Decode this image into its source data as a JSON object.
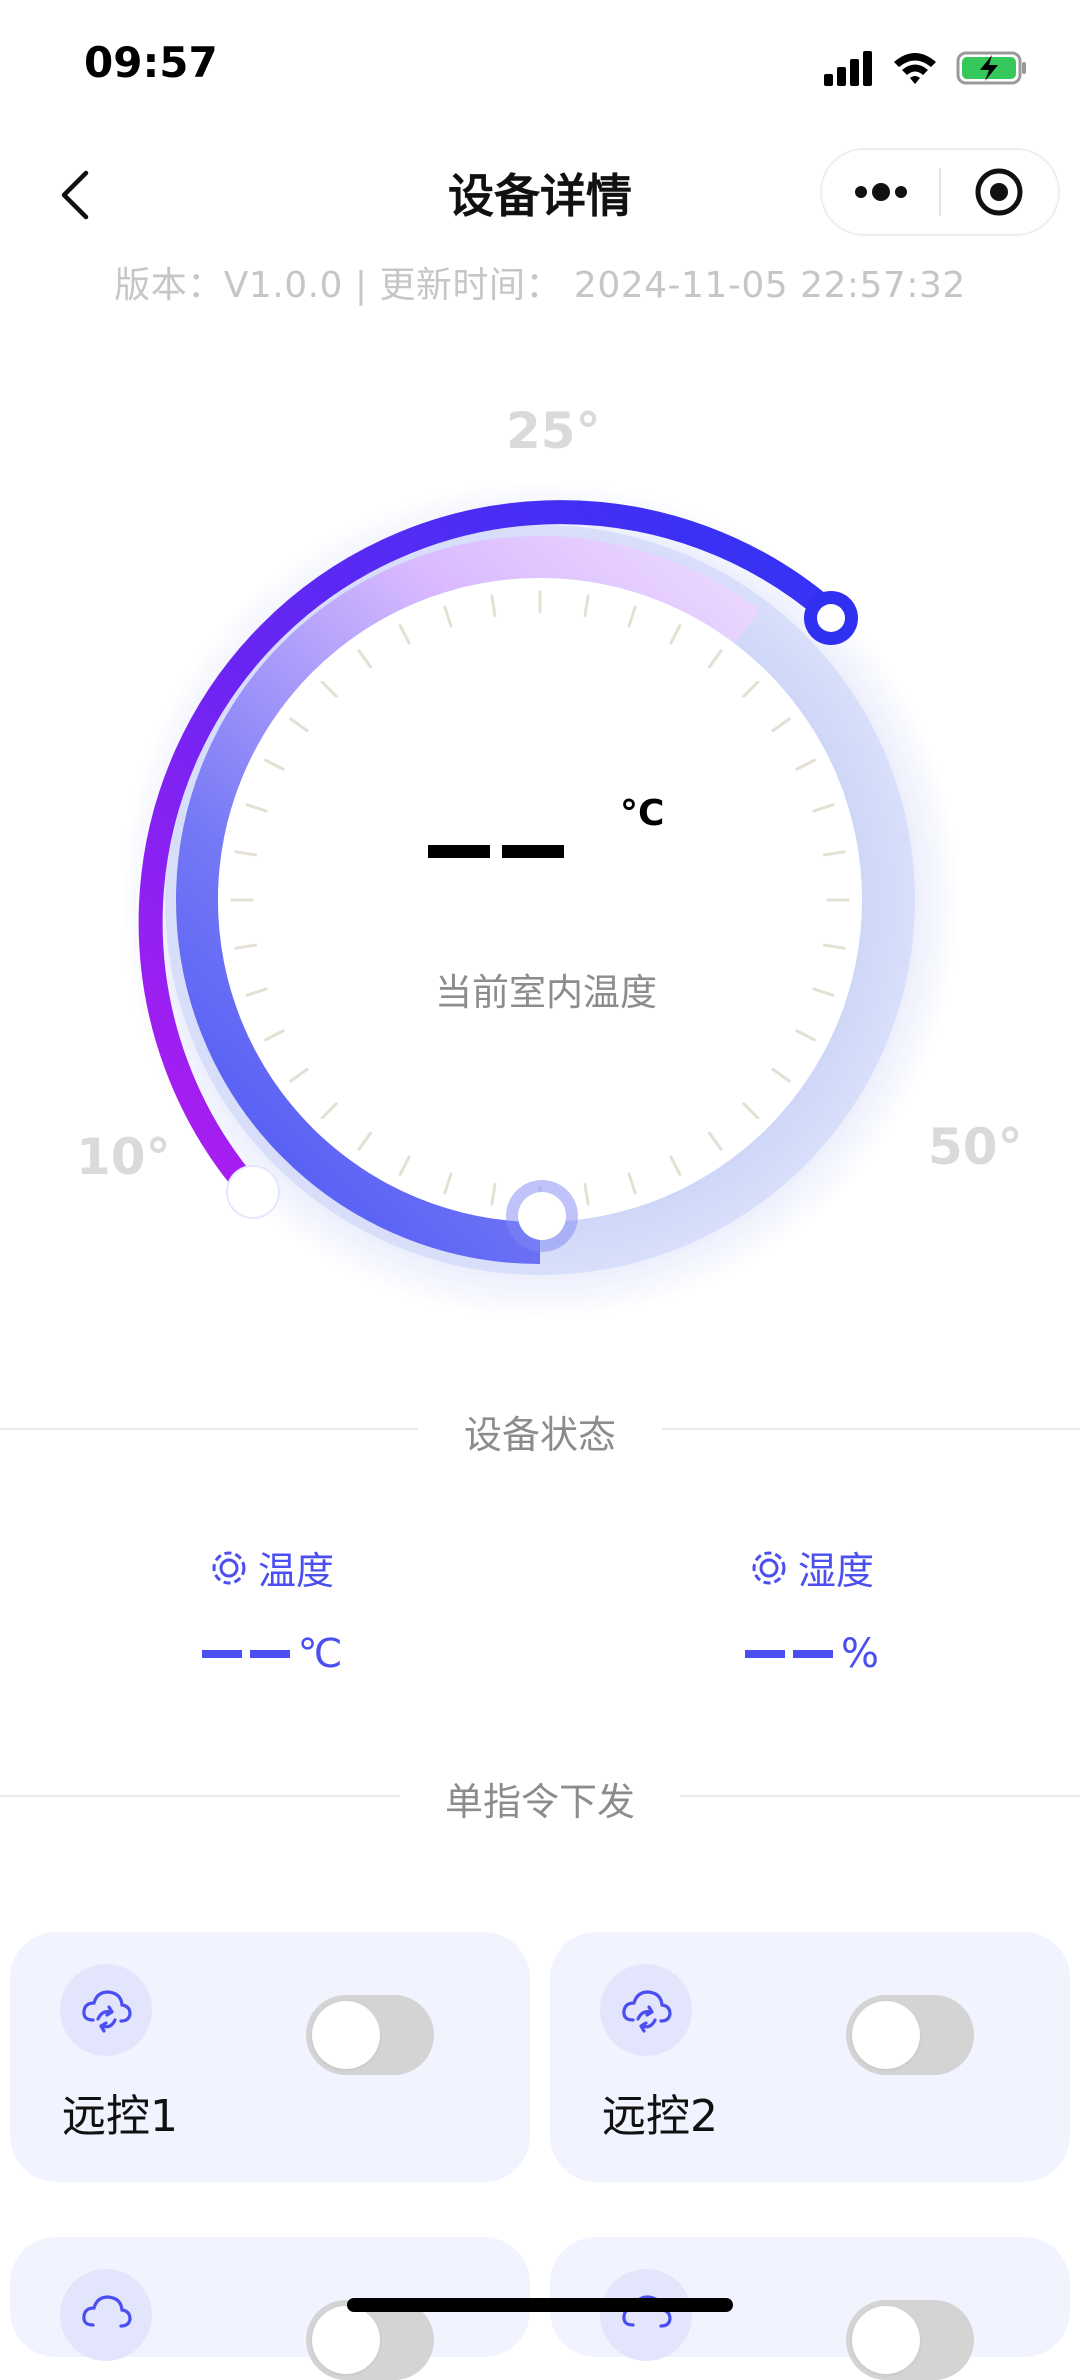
{
  "status_bar": {
    "time": "09:57"
  },
  "nav": {
    "title": "设备详情"
  },
  "version_line": "版本：V1.0.0 | 更新时间： 2024-11-05 22:57:32",
  "dial": {
    "scale_min_label": "10°",
    "scale_mid_label": "25°",
    "scale_max_label": "50°",
    "unit": "°C",
    "caption": "当前室内温度",
    "current_reading": null,
    "gradient_colors": [
      "#b21cf0",
      "#3d2ff5",
      "#4d5af5"
    ]
  },
  "sections": {
    "device_status": "设备状态",
    "single_command": "单指令下发"
  },
  "stats": [
    {
      "label": "温度",
      "unit": "℃"
    },
    {
      "label": "湿度",
      "unit": "%"
    }
  ],
  "cards": [
    {
      "label": "远控1",
      "on": false
    },
    {
      "label": "远控2",
      "on": false
    }
  ],
  "colors": {
    "accent": "#4b4ff0",
    "card_bg": "#f1f3ff",
    "toggle_off": "#d4d4d4"
  }
}
